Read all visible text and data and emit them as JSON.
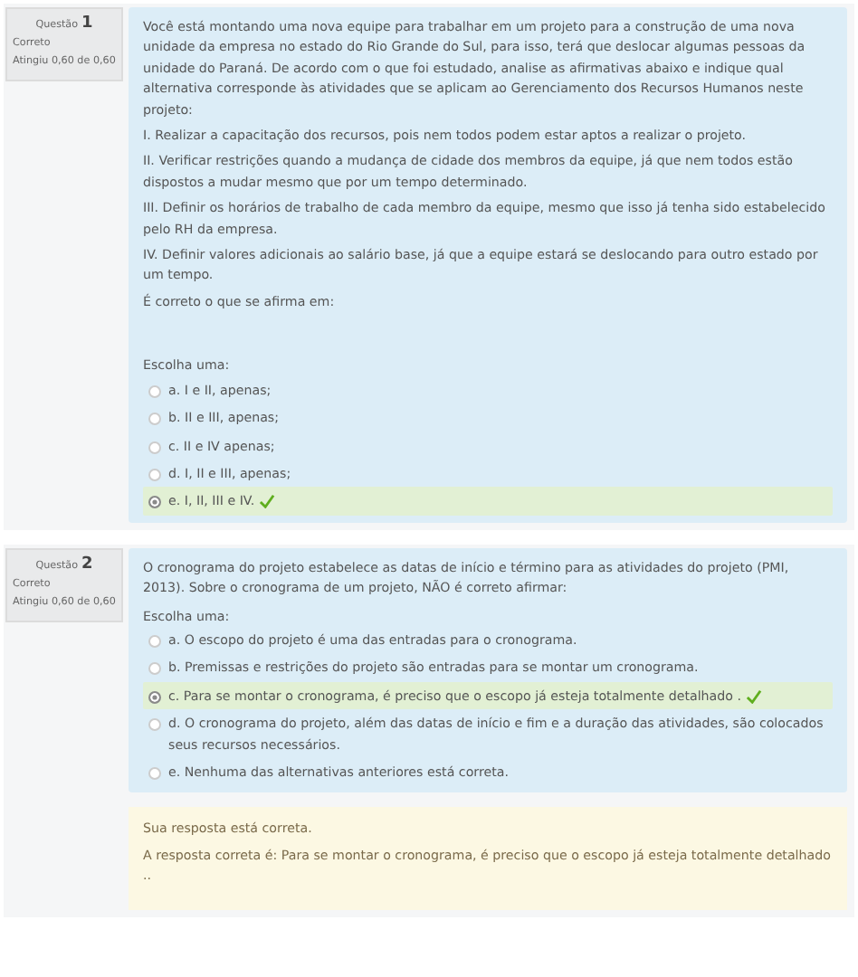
{
  "questions": [
    {
      "label": "Questão",
      "number": "1",
      "status": "Correto",
      "grade": "Atingiu 0,60 de 0,60",
      "paragraphs": [
        "Você está montando uma nova equipe para trabalhar em um projeto para a construção de uma nova unidade da empresa no estado do Rio Grande do Sul, para isso, terá que deslocar algumas pessoas da unidade do Paraná. De acordo com o que foi estudado, analise as afirmativas abaixo e indique qual alternativa corresponde às atividades que se aplicam ao Gerenciamento dos Recursos Humanos neste projeto:",
        "I. Realizar a capacitação dos recursos, pois nem todos podem estar aptos a realizar o projeto.",
        "II. Verificar restrições quando a mudança de cidade dos membros da equipe, já que nem todos estão dispostos a mudar mesmo que por um tempo determinado.",
        "III. Definir os horários de trabalho de cada membro da equipe, mesmo que isso já tenha sido estabelecido pelo RH da empresa.",
        "IV. Definir valores adicionais ao salário base, já que a equipe estará se deslocando para outro estado por um tempo.",
        "É correto o que se afirma em:"
      ],
      "prompt": "Escolha uma:",
      "options": [
        {
          "text": "a. I e II, apenas;",
          "selected": false
        },
        {
          "text": "b. II e III, apenas;",
          "selected": false
        },
        {
          "text": "c. II e IV apenas;",
          "selected": false
        },
        {
          "text": "d. I, II e III, apenas;",
          "selected": false
        },
        {
          "text": "e. I, II, III e IV.",
          "selected": true
        }
      ]
    },
    {
      "label": "Questão",
      "number": "2",
      "status": "Correto",
      "grade": "Atingiu 0,60 de 0,60",
      "paragraphs": [
        "O cronograma do projeto estabelece as datas de início e término para as atividades do projeto (PMI, 2013). Sobre o cronograma de um projeto, NÃO é correto afirmar:"
      ],
      "prompt": "Escolha uma:",
      "options": [
        {
          "text": "a. O escopo do projeto é uma das entradas para o cronograma.",
          "selected": false
        },
        {
          "text": "b. Premissas e restrições do projeto são entradas para se montar um cronograma.",
          "selected": false
        },
        {
          "text": "c. Para se montar o cronograma, é preciso que o escopo já esteja totalmente detalhado .",
          "selected": true
        },
        {
          "text": "d. O cronograma do projeto, além das datas de início e fim e a duração das atividades, são colocados seus recursos necessários.",
          "selected": false
        },
        {
          "text": "e. Nenhuma das alternativas anteriores está correta.",
          "selected": false
        }
      ],
      "feedback": [
        "Sua resposta está correta.",
        "A resposta correta é: Para se montar o cronograma, é preciso que o escopo já esteja totalmente detalhado .."
      ]
    }
  ]
}
